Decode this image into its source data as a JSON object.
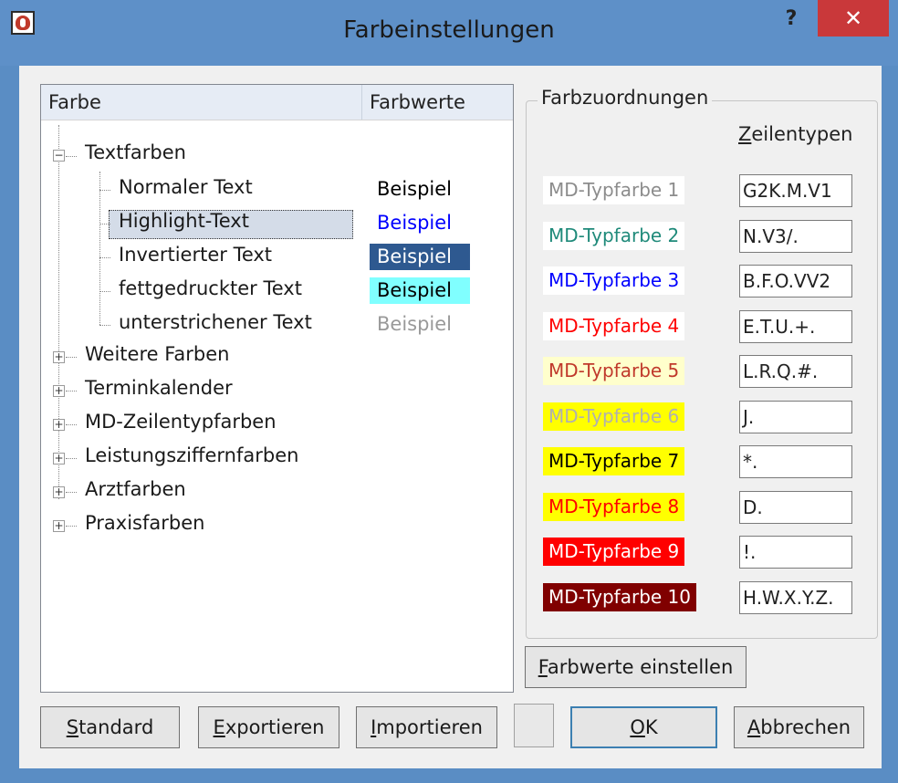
{
  "window": {
    "title": "Farbeinstellungen",
    "help_label": "?",
    "close_label": "✕"
  },
  "tree": {
    "headers": {
      "farbe": "Farbe",
      "farbwerte": "Farbwerte"
    },
    "root": {
      "label": "Textfarben",
      "children": [
        {
          "label": "Normaler Text",
          "sample": "Beispiel",
          "sample_fg": "#000000",
          "sample_bg": "#ffffff"
        },
        {
          "label": "Highlight-Text",
          "sample": "Beispiel",
          "sample_fg": "#0000ff",
          "sample_bg": "#ffffff"
        },
        {
          "label": "Invertierter Text",
          "sample": "Beispiel",
          "sample_fg": "#ffffff",
          "sample_bg": "#2e5990"
        },
        {
          "label": "fettgedruckter Text",
          "sample": "Beispiel",
          "sample_fg": "#000000",
          "sample_bg": "#80ffff"
        },
        {
          "label": "unterstrichener Text",
          "sample": "Beispiel",
          "sample_fg": "#999999",
          "sample_bg": "#ffffff"
        }
      ]
    },
    "collapsed": [
      "Weitere Farben",
      "Terminkalender",
      "MD-Zeilentypfarben",
      "Leistungsziffernfarben",
      "Arztfarben",
      "Praxisfarben"
    ]
  },
  "farbzuordnungen": {
    "title": "Farbzuordnungen",
    "zeilentypen_header": "Zeilentypen",
    "rows": [
      {
        "label": "MD-Typfarbe 1",
        "fg": "#8c8c8c",
        "bg": "#ffffff",
        "value": "G2K.M.V1"
      },
      {
        "label": "MD-Typfarbe 2",
        "fg": "#1f8a7a",
        "bg": "#ffffff",
        "value": "N.V3/."
      },
      {
        "label": "MD-Typfarbe 3",
        "fg": "#0000ff",
        "bg": "#ffffff",
        "value": "B.F.O.VV2"
      },
      {
        "label": "MD-Typfarbe 4",
        "fg": "#ff0000",
        "bg": "#ffffff",
        "value": "E.T.U.+."
      },
      {
        "label": "MD-Typfarbe 5",
        "fg": "#c0392b",
        "bg": "#ffffcc",
        "value": "L.R.Q.#."
      },
      {
        "label": "MD-Typfarbe 6",
        "fg": "#b0b0b0",
        "bg": "#ffff00",
        "value": "J."
      },
      {
        "label": "MD-Typfarbe 7",
        "fg": "#000000",
        "bg": "#ffff00",
        "value": "*."
      },
      {
        "label": "MD-Typfarbe 8",
        "fg": "#ff0000",
        "bg": "#ffff00",
        "value": "D."
      },
      {
        "label": "MD-Typfarbe 9",
        "fg": "#ffffff",
        "bg": "#ff0000",
        "value": "!."
      },
      {
        "label": "MD-Typfarbe 10",
        "fg": "#ffffff",
        "bg": "#800000",
        "value": "H.W.X.Y.Z."
      }
    ],
    "farbwerte_button": "Farbwerte einstellen"
  },
  "buttons": {
    "standard": "Standard",
    "exportieren": "Exportieren",
    "importieren": "Importieren",
    "ok": "OK",
    "abbrechen": "Abbrechen"
  }
}
